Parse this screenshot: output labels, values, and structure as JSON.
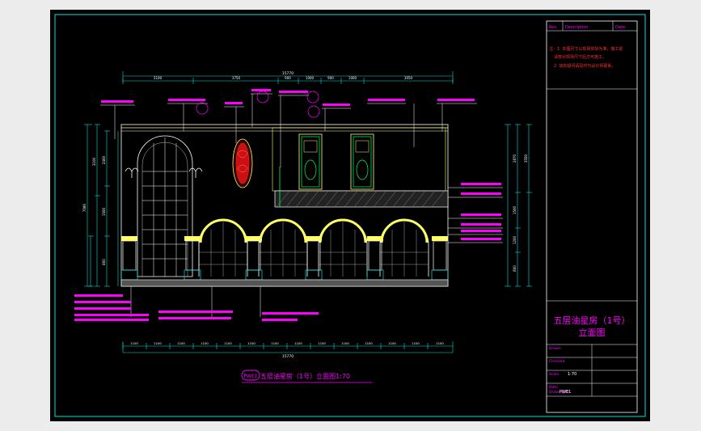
{
  "drawing": {
    "title_label": "五层油星房（1号）立面图1:70",
    "callout_tag": "PWE1",
    "overall_dimension": "15770",
    "top_dimensions": [
      "3100",
      "3750",
      "900",
      "1000",
      "900",
      "1000",
      "3050"
    ],
    "bottom_dimensions": [
      "1100",
      "1100",
      "1100",
      "1100",
      "1100",
      "1100",
      "1100",
      "1100",
      "1100",
      "1100",
      "1100",
      "1100",
      "1100",
      "1100"
    ],
    "left_dimensions": [
      "7080",
      "3100",
      "2400",
      "1500",
      "800"
    ],
    "right_dimensions": [
      "2870",
      "3550",
      "1500",
      "1200",
      "800"
    ]
  },
  "title_block": {
    "header_cols": [
      "Rev.",
      "Description",
      "Date"
    ],
    "notes": [
      "注：1. 本图尺寸以现场实际为准，施工前",
      "请核对现场尺寸后方可施工。",
      "2. 如有疑问请及时与设计师联系。"
    ],
    "project_title_line1": "五层油星房（1号）",
    "project_title_line2": "立面图",
    "rows": [
      "Drawn",
      "Checked",
      "Scale",
      "Date",
      "Drawing No."
    ],
    "scale_value": "1:70",
    "drawing_no": "PWE1"
  },
  "colors": {
    "background": "#000000",
    "frame": "#00e0e0",
    "annotation": "#ff00ff",
    "outline": "#ffffff",
    "accent_yellow": "#ffff66",
    "accent_green": "#00ff66",
    "ornament_red": "#ff2020",
    "title_red": "#ff3333"
  }
}
